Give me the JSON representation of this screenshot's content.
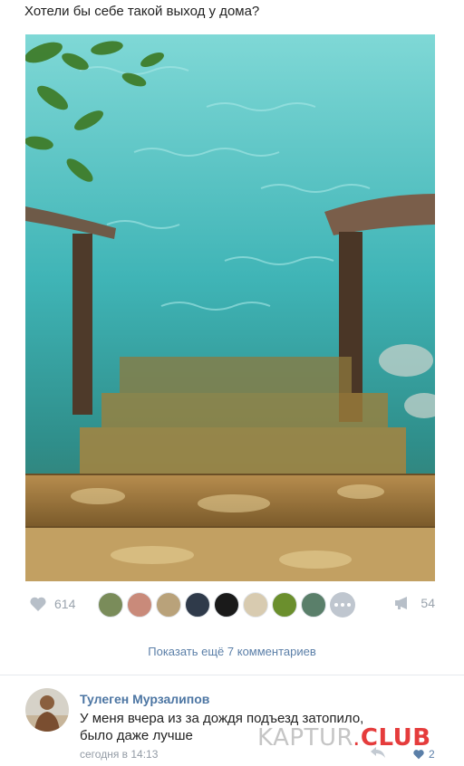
{
  "post": {
    "text": "Хотели бы себе такой выход у дома?",
    "photo_icon": "photo-stairs-into-water"
  },
  "actions": {
    "like_icon": "heart-icon",
    "likes_count": "614",
    "liker_avatars": [
      {
        "color": "#7a8c5a"
      },
      {
        "color": "#c98a7a"
      },
      {
        "color": "#b9a27a"
      },
      {
        "color": "#2f3a4a"
      },
      {
        "color": "#1a1a1a"
      },
      {
        "color": "#d8cbb0"
      },
      {
        "color": "#6b8f2d"
      },
      {
        "color": "#5a7f6a"
      }
    ],
    "more_icon": "more-dots-icon",
    "share_icon": "megaphone-icon",
    "shares_count": "54"
  },
  "comments": {
    "show_more_label": "Показать ещё 7 комментариев",
    "items": [
      {
        "author": "Тулеген Мурзалипов",
        "text_line1": "У меня вчера из за дождя подъезд затопило,",
        "text_line2": "было даже лучше",
        "time": "сегодня в 14:13",
        "likes": "2",
        "reply_icon": "reply-arrow-icon",
        "like_icon": "heart-icon"
      }
    ]
  },
  "watermark": {
    "part1": "KAPTUR",
    "dot": ".",
    "part2": "CLUB"
  },
  "colors": {
    "link": "#5b7fa8",
    "author": "#4d76a3",
    "muted": "#9aa3ad"
  }
}
